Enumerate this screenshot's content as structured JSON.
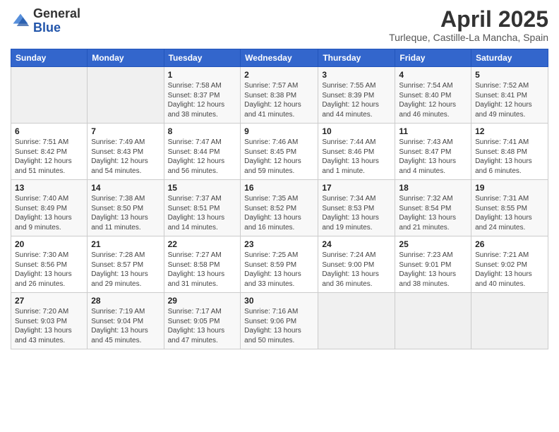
{
  "logo": {
    "general": "General",
    "blue": "Blue"
  },
  "header": {
    "month_year": "April 2025",
    "location": "Turleque, Castille-La Mancha, Spain"
  },
  "days_of_week": [
    "Sunday",
    "Monday",
    "Tuesday",
    "Wednesday",
    "Thursday",
    "Friday",
    "Saturday"
  ],
  "weeks": [
    [
      {
        "day": "",
        "sunrise": "",
        "sunset": "",
        "daylight": ""
      },
      {
        "day": "",
        "sunrise": "",
        "sunset": "",
        "daylight": ""
      },
      {
        "day": "1",
        "sunrise": "Sunrise: 7:58 AM",
        "sunset": "Sunset: 8:37 PM",
        "daylight": "Daylight: 12 hours and 38 minutes."
      },
      {
        "day": "2",
        "sunrise": "Sunrise: 7:57 AM",
        "sunset": "Sunset: 8:38 PM",
        "daylight": "Daylight: 12 hours and 41 minutes."
      },
      {
        "day": "3",
        "sunrise": "Sunrise: 7:55 AM",
        "sunset": "Sunset: 8:39 PM",
        "daylight": "Daylight: 12 hours and 44 minutes."
      },
      {
        "day": "4",
        "sunrise": "Sunrise: 7:54 AM",
        "sunset": "Sunset: 8:40 PM",
        "daylight": "Daylight: 12 hours and 46 minutes."
      },
      {
        "day": "5",
        "sunrise": "Sunrise: 7:52 AM",
        "sunset": "Sunset: 8:41 PM",
        "daylight": "Daylight: 12 hours and 49 minutes."
      }
    ],
    [
      {
        "day": "6",
        "sunrise": "Sunrise: 7:51 AM",
        "sunset": "Sunset: 8:42 PM",
        "daylight": "Daylight: 12 hours and 51 minutes."
      },
      {
        "day": "7",
        "sunrise": "Sunrise: 7:49 AM",
        "sunset": "Sunset: 8:43 PM",
        "daylight": "Daylight: 12 hours and 54 minutes."
      },
      {
        "day": "8",
        "sunrise": "Sunrise: 7:47 AM",
        "sunset": "Sunset: 8:44 PM",
        "daylight": "Daylight: 12 hours and 56 minutes."
      },
      {
        "day": "9",
        "sunrise": "Sunrise: 7:46 AM",
        "sunset": "Sunset: 8:45 PM",
        "daylight": "Daylight: 12 hours and 59 minutes."
      },
      {
        "day": "10",
        "sunrise": "Sunrise: 7:44 AM",
        "sunset": "Sunset: 8:46 PM",
        "daylight": "Daylight: 13 hours and 1 minute."
      },
      {
        "day": "11",
        "sunrise": "Sunrise: 7:43 AM",
        "sunset": "Sunset: 8:47 PM",
        "daylight": "Daylight: 13 hours and 4 minutes."
      },
      {
        "day": "12",
        "sunrise": "Sunrise: 7:41 AM",
        "sunset": "Sunset: 8:48 PM",
        "daylight": "Daylight: 13 hours and 6 minutes."
      }
    ],
    [
      {
        "day": "13",
        "sunrise": "Sunrise: 7:40 AM",
        "sunset": "Sunset: 8:49 PM",
        "daylight": "Daylight: 13 hours and 9 minutes."
      },
      {
        "day": "14",
        "sunrise": "Sunrise: 7:38 AM",
        "sunset": "Sunset: 8:50 PM",
        "daylight": "Daylight: 13 hours and 11 minutes."
      },
      {
        "day": "15",
        "sunrise": "Sunrise: 7:37 AM",
        "sunset": "Sunset: 8:51 PM",
        "daylight": "Daylight: 13 hours and 14 minutes."
      },
      {
        "day": "16",
        "sunrise": "Sunrise: 7:35 AM",
        "sunset": "Sunset: 8:52 PM",
        "daylight": "Daylight: 13 hours and 16 minutes."
      },
      {
        "day": "17",
        "sunrise": "Sunrise: 7:34 AM",
        "sunset": "Sunset: 8:53 PM",
        "daylight": "Daylight: 13 hours and 19 minutes."
      },
      {
        "day": "18",
        "sunrise": "Sunrise: 7:32 AM",
        "sunset": "Sunset: 8:54 PM",
        "daylight": "Daylight: 13 hours and 21 minutes."
      },
      {
        "day": "19",
        "sunrise": "Sunrise: 7:31 AM",
        "sunset": "Sunset: 8:55 PM",
        "daylight": "Daylight: 13 hours and 24 minutes."
      }
    ],
    [
      {
        "day": "20",
        "sunrise": "Sunrise: 7:30 AM",
        "sunset": "Sunset: 8:56 PM",
        "daylight": "Daylight: 13 hours and 26 minutes."
      },
      {
        "day": "21",
        "sunrise": "Sunrise: 7:28 AM",
        "sunset": "Sunset: 8:57 PM",
        "daylight": "Daylight: 13 hours and 29 minutes."
      },
      {
        "day": "22",
        "sunrise": "Sunrise: 7:27 AM",
        "sunset": "Sunset: 8:58 PM",
        "daylight": "Daylight: 13 hours and 31 minutes."
      },
      {
        "day": "23",
        "sunrise": "Sunrise: 7:25 AM",
        "sunset": "Sunset: 8:59 PM",
        "daylight": "Daylight: 13 hours and 33 minutes."
      },
      {
        "day": "24",
        "sunrise": "Sunrise: 7:24 AM",
        "sunset": "Sunset: 9:00 PM",
        "daylight": "Daylight: 13 hours and 36 minutes."
      },
      {
        "day": "25",
        "sunrise": "Sunrise: 7:23 AM",
        "sunset": "Sunset: 9:01 PM",
        "daylight": "Daylight: 13 hours and 38 minutes."
      },
      {
        "day": "26",
        "sunrise": "Sunrise: 7:21 AM",
        "sunset": "Sunset: 9:02 PM",
        "daylight": "Daylight: 13 hours and 40 minutes."
      }
    ],
    [
      {
        "day": "27",
        "sunrise": "Sunrise: 7:20 AM",
        "sunset": "Sunset: 9:03 PM",
        "daylight": "Daylight: 13 hours and 43 minutes."
      },
      {
        "day": "28",
        "sunrise": "Sunrise: 7:19 AM",
        "sunset": "Sunset: 9:04 PM",
        "daylight": "Daylight: 13 hours and 45 minutes."
      },
      {
        "day": "29",
        "sunrise": "Sunrise: 7:17 AM",
        "sunset": "Sunset: 9:05 PM",
        "daylight": "Daylight: 13 hours and 47 minutes."
      },
      {
        "day": "30",
        "sunrise": "Sunrise: 7:16 AM",
        "sunset": "Sunset: 9:06 PM",
        "daylight": "Daylight: 13 hours and 50 minutes."
      },
      {
        "day": "",
        "sunrise": "",
        "sunset": "",
        "daylight": ""
      },
      {
        "day": "",
        "sunrise": "",
        "sunset": "",
        "daylight": ""
      },
      {
        "day": "",
        "sunrise": "",
        "sunset": "",
        "daylight": ""
      }
    ]
  ]
}
